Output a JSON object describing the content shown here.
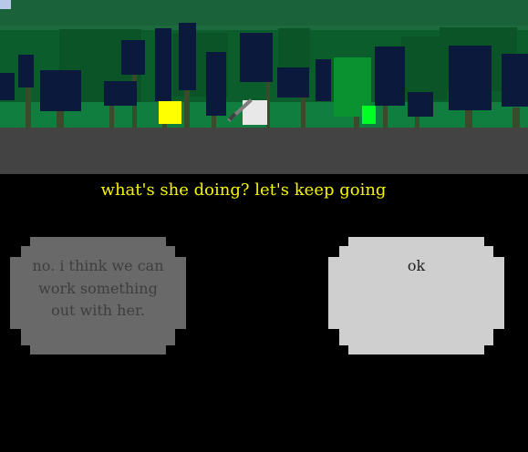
{
  "dialogue": {
    "text": "what's she doing? let's keep going"
  },
  "choices": [
    {
      "label": "no. i think we can work something out with her."
    },
    {
      "label": "ok"
    }
  ],
  "colors": {
    "background": "#000000",
    "sky": "#1d6a3e",
    "ground": "#434343",
    "grass": "#107e3f",
    "dialogue_text": "#f5f500",
    "choice_dim_bg": "#696969",
    "choice_dim_text": "#3e3e3e",
    "choice_active_bg": "#cfcfcf",
    "choice_active_text": "#1e1e1e",
    "character_yellow": "#ffff00",
    "character_green": "#00ff22",
    "character_white": "#e8e8e8"
  }
}
